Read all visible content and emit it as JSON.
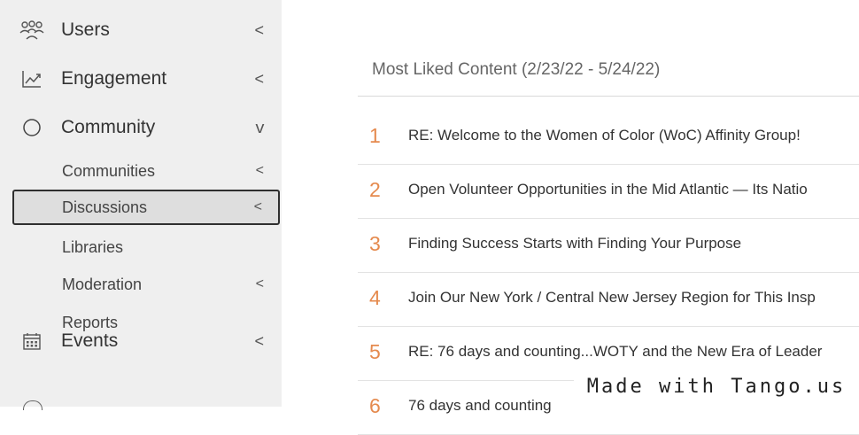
{
  "sidebar": {
    "items": [
      {
        "label": "Users",
        "icon": "users-icon",
        "chevron": "<"
      },
      {
        "label": "Engagement",
        "icon": "chart-trend-icon",
        "chevron": "<"
      },
      {
        "label": "Community",
        "icon": "circle-icon",
        "chevron": "v"
      },
      {
        "label": "Events",
        "icon": "calendar-icon",
        "chevron": "<"
      }
    ],
    "community_sub": [
      {
        "label": "Communities",
        "chevron": "<"
      },
      {
        "label": "Discussions",
        "chevron": "<",
        "selected": true
      },
      {
        "label": "Libraries",
        "chevron": ""
      },
      {
        "label": "Moderation",
        "chevron": "<"
      },
      {
        "label": "Reports",
        "chevron": ""
      }
    ]
  },
  "main": {
    "title": "Most Liked Content (2/23/22 - 5/24/22)",
    "rows": [
      {
        "rank": "1",
        "title": "RE: Welcome to the Women of Color (WoC) Affinity Group!"
      },
      {
        "rank": "2",
        "title": "Open Volunteer Opportunities in the Mid Atlantic — Its Natio"
      },
      {
        "rank": "3",
        "title": "Finding Success Starts with Finding Your Purpose"
      },
      {
        "rank": "4",
        "title": "Join Our New York / Central New Jersey Region for This Insp"
      },
      {
        "rank": "5",
        "title": "RE: 76 days and counting...WOTY and the New Era of Leader"
      },
      {
        "rank": "6",
        "title": "76 days and counting"
      }
    ]
  },
  "watermark": "Made with Tango.us",
  "colors": {
    "rank": "#e58a4e",
    "sidebar_bg": "#efefef",
    "selected_border": "#2f2f2f"
  }
}
